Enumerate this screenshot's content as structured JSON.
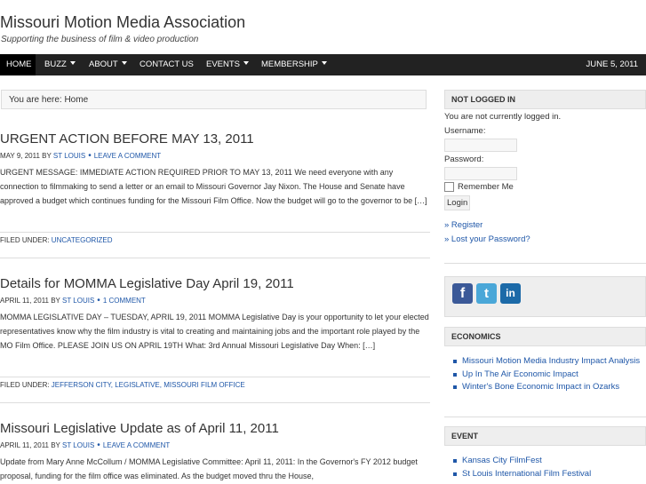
{
  "header": {
    "title": "Missouri Motion Media Association",
    "tagline": "Supporting the business of film & video production"
  },
  "nav": {
    "items": [
      {
        "label": "HOME",
        "active": true
      },
      {
        "label": "BUZZ",
        "dropdown": true
      },
      {
        "label": "ABOUT",
        "dropdown": true
      },
      {
        "label": "CONTACT US",
        "dropdown": false
      },
      {
        "label": "EVENTS",
        "dropdown": true
      },
      {
        "label": "MEMBERSHIP",
        "dropdown": true
      }
    ],
    "date": "JUNE 5, 2011"
  },
  "breadcrumb": "You are here: Home",
  "posts": [
    {
      "title": "URGENT ACTION BEFORE MAY 13, 2011",
      "date": "MAY 9, 2011 BY",
      "author": "ST LOUIS",
      "comment_link": "LEAVE A COMMENT",
      "excerpt": "URGENT MESSAGE: IMMEDIATE ACTION REQUIRED PRIOR TO MAY 13, 2011 We need everyone with any connection to filmmaking to send a letter or an email to Missouri Governor Jay Nixon.  The House and Senate have approved a budget which continues funding for the Missouri Film Office.   Now the budget will go to the governor to be […]",
      "filed_label": "FILED UNDER:",
      "categories": "UNCATEGORIZED"
    },
    {
      "title": "Details for MOMMA Legislative Day April 19, 2011",
      "date": "APRIL 11, 2011 BY",
      "author": "ST LOUIS",
      "comment_link": "1 COMMENT",
      "excerpt": "MOMMA LEGISLATIVE DAY – TUESDAY, APRIL 19, 2011 MOMMA Legislative Day is your opportunity to let your elected representatives know why the film industry is vital to creating and maintaining jobs and the important role played by the MO Film Office. PLEASE JOIN US ON APRIL 19TH What:                3rd Annual Missouri Legislative Day When:                […]",
      "filed_label": "FILED UNDER:",
      "categories": "JEFFERSON CITY, LEGISLATIVE, MISSOURI FILM OFFICE"
    },
    {
      "title": "Missouri Legislative Update as of April 11, 2011",
      "date": "APRIL 11, 2011 BY",
      "author": "ST LOUIS",
      "comment_link": "LEAVE A COMMENT",
      "excerpt": "Update from Mary Anne McCollum / MOMMA Legislative Committee: April 11, 2011: In the Governor's FY 2012 budget proposal, funding for the film office was eliminated.  As the budget moved thru the House,"
    }
  ],
  "sidebar": {
    "login": {
      "heading": "NOT LOGGED IN",
      "status": "You are not currently logged in.",
      "username_label": "Username:",
      "password_label": "Password:",
      "remember_label": "Remember Me",
      "login_button": "Login",
      "register_link": "» Register",
      "lost_password_link": "» Lost your Password?"
    },
    "social": [
      {
        "icon": "facebook-icon",
        "glyph": "f",
        "color": "#3b5998"
      },
      {
        "icon": "twitter-icon",
        "glyph": "t",
        "color": "#4aa7d8"
      },
      {
        "icon": "linkedin-icon",
        "glyph": "in",
        "color": "#1c6aa8"
      }
    ],
    "economics": {
      "heading": "ECONOMICS",
      "items": [
        "Missouri Motion Media Industry Impact Analysis",
        "Up In The Air Economic Impact",
        "Winter's Bone Economic Impact in Ozarks"
      ]
    },
    "event": {
      "heading": "EVENT",
      "items": [
        "Kansas City FilmFest",
        "St Louis International Film Festival"
      ]
    }
  }
}
